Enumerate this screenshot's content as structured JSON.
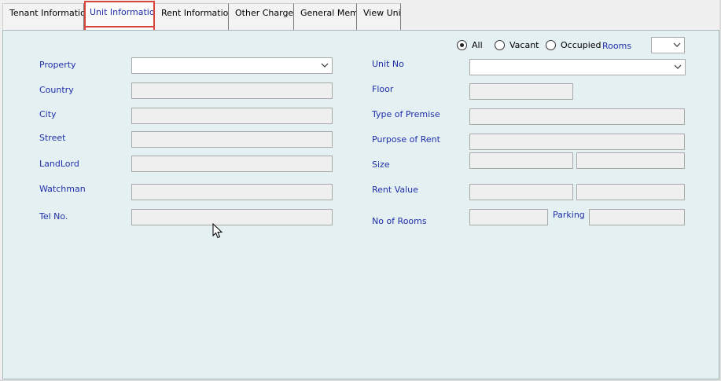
{
  "tabs": [
    {
      "label": "Tenant Information"
    },
    {
      "label": "Unit Information"
    },
    {
      "label": "Rent Information"
    },
    {
      "label": "Other Charges"
    },
    {
      "label": "General Memo"
    },
    {
      "label": "View Unit"
    }
  ],
  "filter": {
    "options": [
      {
        "label": "All",
        "selected": true
      },
      {
        "label": "Vacant",
        "selected": false
      },
      {
        "label": "Occupied",
        "selected": false
      }
    ],
    "rooms_label": "Rooms",
    "rooms_value": ""
  },
  "left_form": {
    "property_label": "Property",
    "property_value": "",
    "country_label": "Country",
    "country_value": "",
    "city_label": "City",
    "city_value": "",
    "street_label": "Street",
    "street_value": "",
    "landlord_label": "LandLord",
    "landlord_value": "",
    "watchman_label": "Watchman",
    "watchman_value": "",
    "tel_label": "Tel No.",
    "tel_value": ""
  },
  "right_form": {
    "unit_no_label": "Unit No",
    "unit_no_value": "",
    "floor_label": "Floor",
    "floor_value": "",
    "type_label": "Type of Premise",
    "type_value": "",
    "purpose_label": "Purpose of Rent",
    "purpose_value": "",
    "size_label": "Size",
    "size_value_1": "",
    "size_value_2": "",
    "rent_value_label": "Rent Value",
    "rent_value_1": "",
    "rent_value_2": "",
    "no_rooms_label": "No of Rooms",
    "no_rooms_value": "",
    "parking_label": "Parking",
    "parking_value": ""
  },
  "colors": {
    "label": "#1f2fa8",
    "panel": "#e5f0f3",
    "active_tab_outline": "#d9453a"
  }
}
